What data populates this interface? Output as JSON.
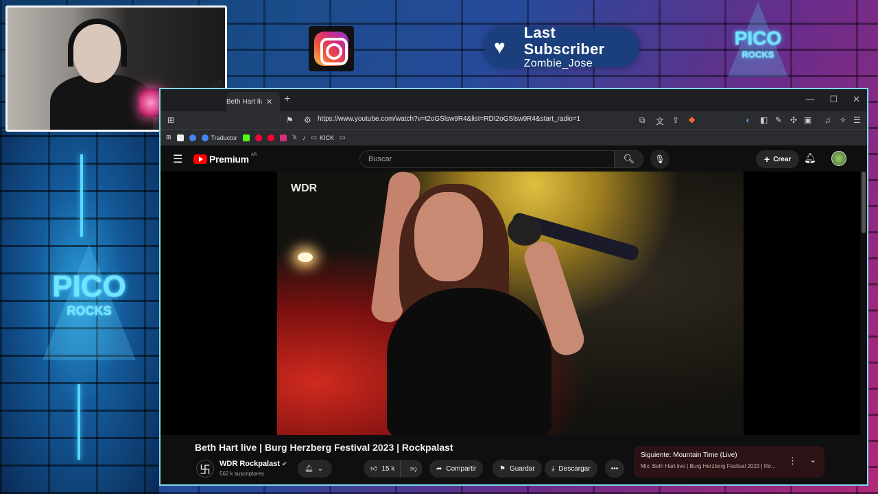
{
  "overlay": {
    "last_subscriber_title": "Last Subscriber",
    "last_subscriber_name": "Zombie_Jose",
    "logo_word": "PICO",
    "logo_sub": "ROCKS"
  },
  "browser": {
    "tab_title": "Beth Hart live | Burg Herzberg",
    "url": "https://www.youtube.com/watch?v=t2oGSlsw9R4&list=RDt2oGSlsw9R4&start_radio=1",
    "bookmarks": [
      {
        "label": "Traductor"
      },
      {
        "label": "KICK"
      }
    ]
  },
  "youtube": {
    "brand": "Premium",
    "region": "AR",
    "search_placeholder": "Buscar",
    "create_label": "Crear",
    "video_watermark": "WDR",
    "video_title": "Beth Hart live | Burg Herzberg Festival 2023 | Rockpalast",
    "channel_name": "WDR Rockpalast",
    "channel_subs": "562 k suscriptores",
    "likes": "15 k",
    "share_label": "Compartir",
    "save_label": "Guardar",
    "download_label": "Descargar",
    "next_label": "Siguiente: Mountain Time (Live)",
    "next_sub": "Mix: Beth Hart live | Burg Herzberg Festival 2023 | Ro..."
  }
}
